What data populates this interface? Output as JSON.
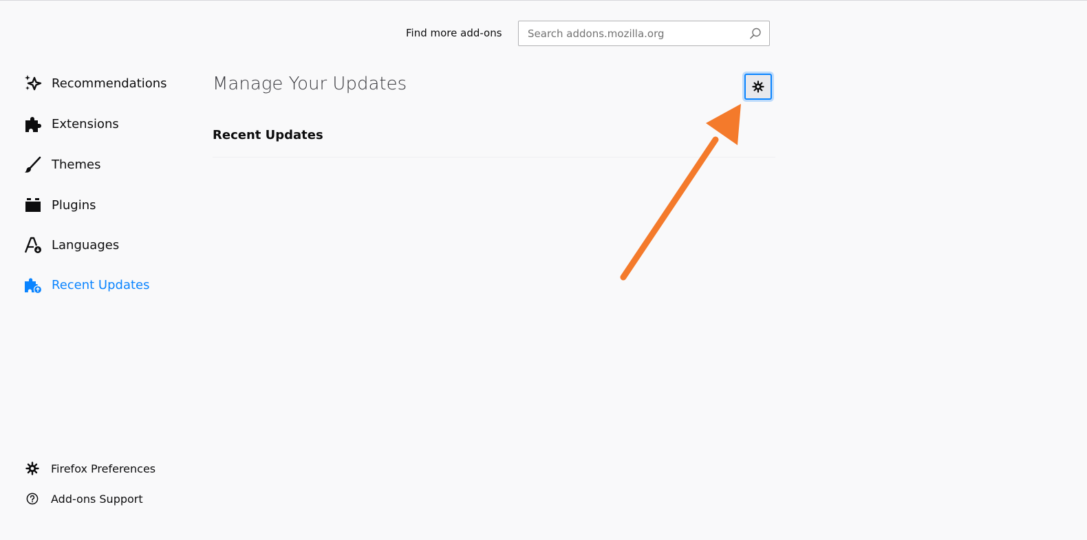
{
  "header": {
    "find_more_label": "Find more add-ons",
    "search_placeholder": "Search addons.mozilla.org"
  },
  "sidebar": {
    "categories": [
      {
        "label": "Recommendations",
        "icon": "sparkle-icon"
      },
      {
        "label": "Extensions",
        "icon": "puzzle-icon"
      },
      {
        "label": "Themes",
        "icon": "brush-icon"
      },
      {
        "label": "Plugins",
        "icon": "plugin-icon"
      },
      {
        "label": "Languages",
        "icon": "language-icon"
      },
      {
        "label": "Recent Updates",
        "icon": "recent-updates-icon",
        "selected": true
      }
    ],
    "footer": [
      {
        "label": "Firefox Preferences",
        "icon": "gear-icon"
      },
      {
        "label": "Add-ons Support",
        "icon": "help-icon"
      }
    ]
  },
  "main": {
    "title": "Manage Your Updates",
    "section_title": "Recent Updates"
  },
  "colors": {
    "accent": "#0a84ff",
    "annotation_arrow": "#f47a2b",
    "background": "#f9f9fa"
  }
}
